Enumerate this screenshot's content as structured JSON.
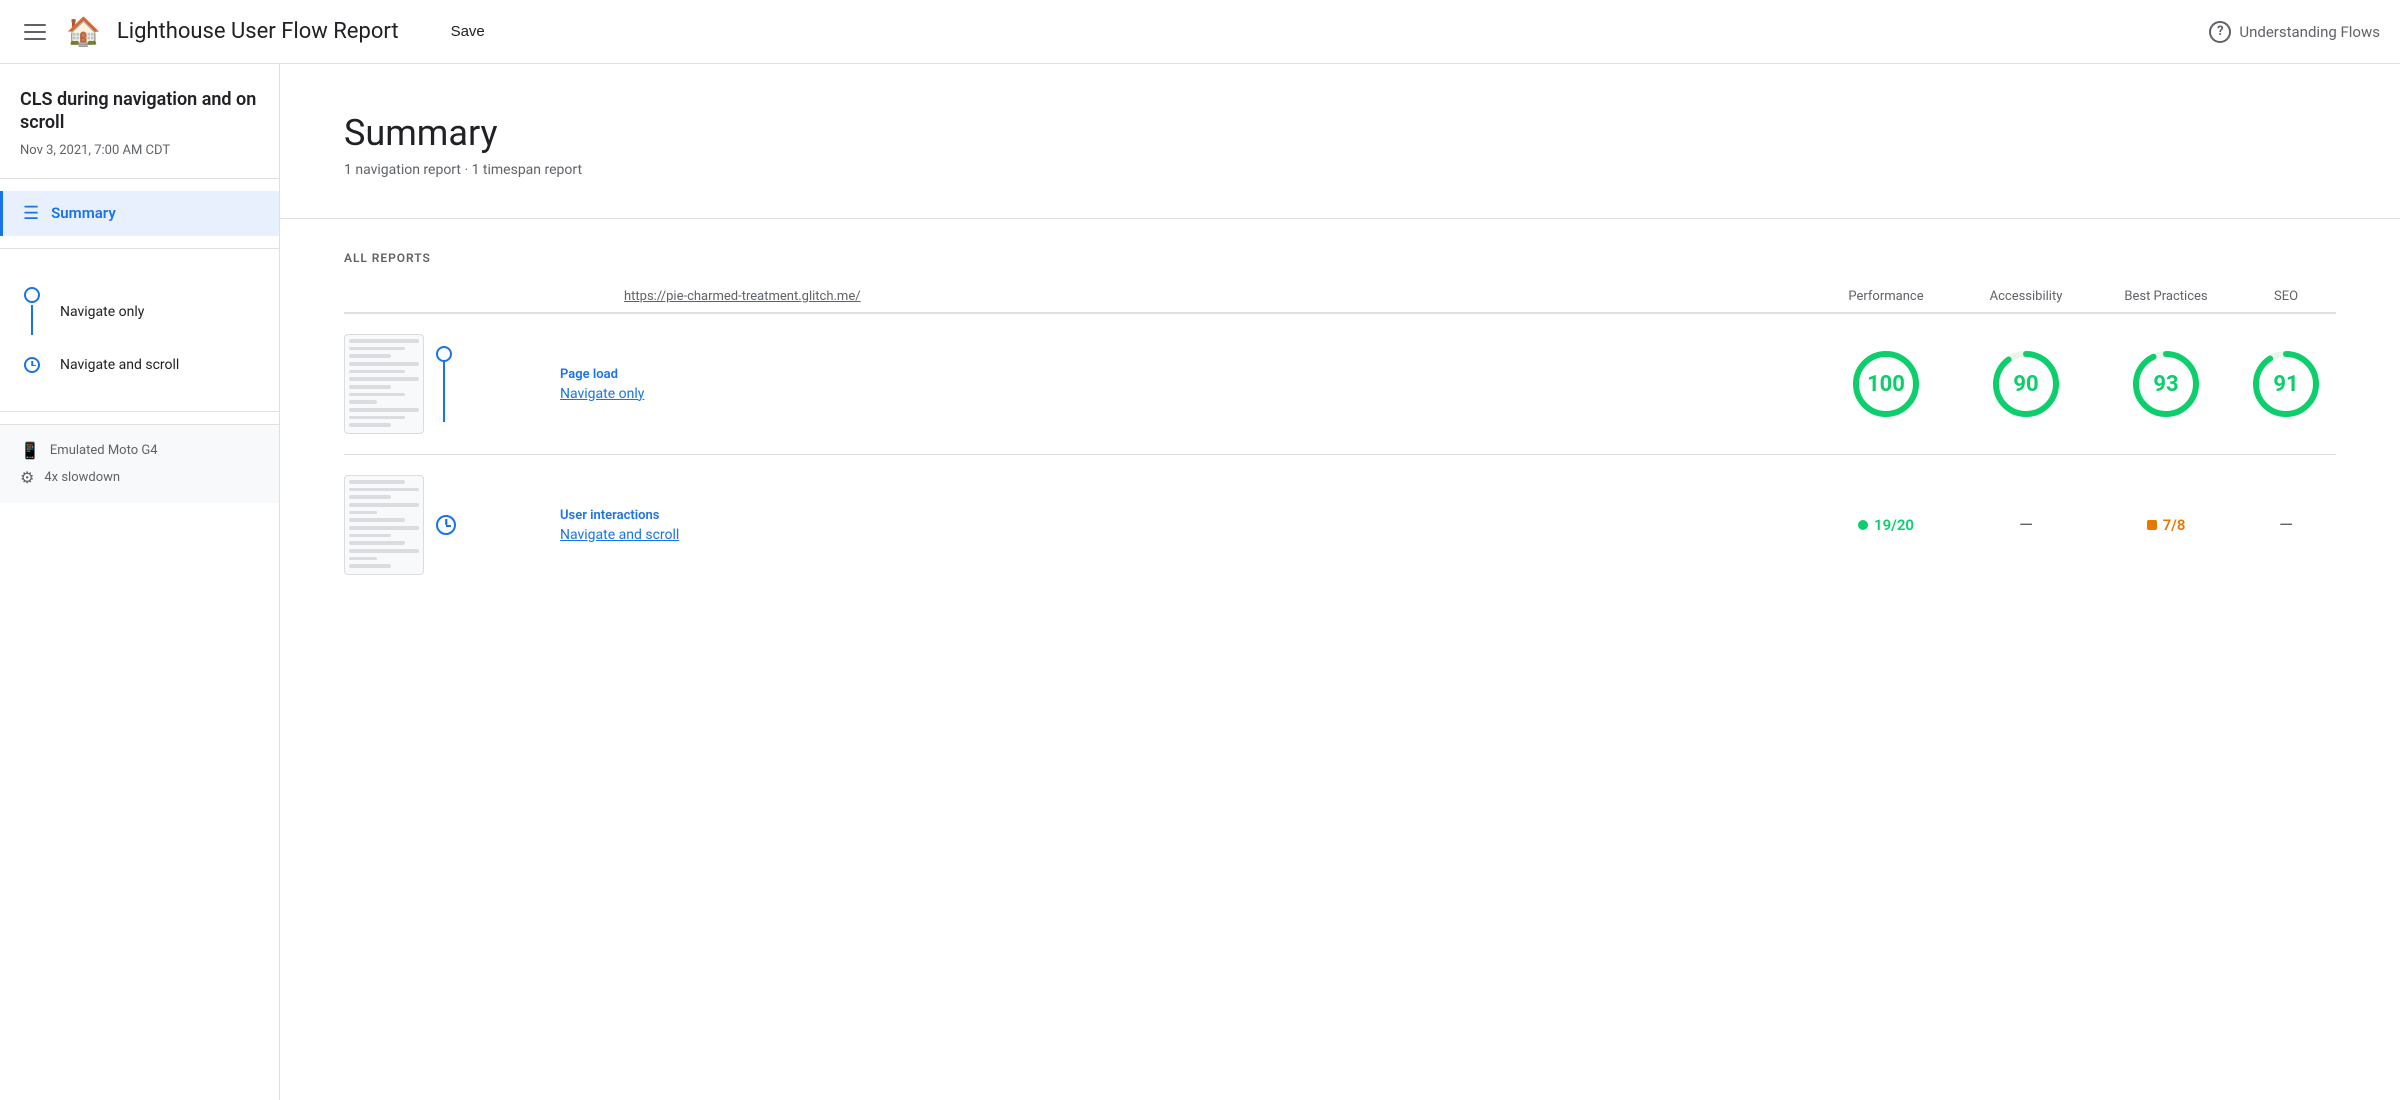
{
  "header": {
    "title": "Lighthouse User Flow Report",
    "save_label": "Save",
    "understanding_flows_label": "Understanding Flows",
    "help_icon_label": "?"
  },
  "sidebar": {
    "report_title": "CLS during navigation and on scroll",
    "report_date": "Nov 3, 2021, 7:00 AM CDT",
    "summary_label": "Summary",
    "flow_items": [
      {
        "label": "Navigate only",
        "type": "circle"
      },
      {
        "label": "Navigate and scroll",
        "type": "clock"
      }
    ],
    "env": {
      "device": "Emulated Moto G4",
      "slowdown": "4x slowdown"
    }
  },
  "summary": {
    "title": "Summary",
    "subtitle": "1 navigation report · 1 timespan report"
  },
  "all_reports": {
    "label": "ALL REPORTS",
    "col_url": "https://pie-charmed-treatment.glitch.me/",
    "col_performance": "Performance",
    "col_accessibility": "Accessibility",
    "col_best_practices": "Best Practices",
    "col_seo": "SEO",
    "rows": [
      {
        "type": "Page load",
        "name": "Navigate only",
        "connector_type": "circle",
        "performance": {
          "kind": "circle",
          "value": "100",
          "color": "#0cce6b",
          "pct": 100
        },
        "accessibility": {
          "kind": "circle",
          "value": "90",
          "color": "#0cce6b",
          "pct": 90
        },
        "best_practices": {
          "kind": "circle",
          "value": "93",
          "color": "#0cce6b",
          "pct": 93
        },
        "seo": {
          "kind": "circle",
          "value": "91",
          "color": "#0cce6b",
          "pct": 91
        }
      },
      {
        "type": "User interactions",
        "name": "Navigate and scroll",
        "connector_type": "clock",
        "performance": {
          "kind": "badge",
          "dot": "green",
          "value": "19/20",
          "color": "#0cce6b"
        },
        "accessibility": {
          "kind": "dash"
        },
        "best_practices": {
          "kind": "badge",
          "dot": "orange",
          "value": "7/8",
          "color": "#e67700"
        },
        "seo": {
          "kind": "dash"
        }
      }
    ]
  }
}
